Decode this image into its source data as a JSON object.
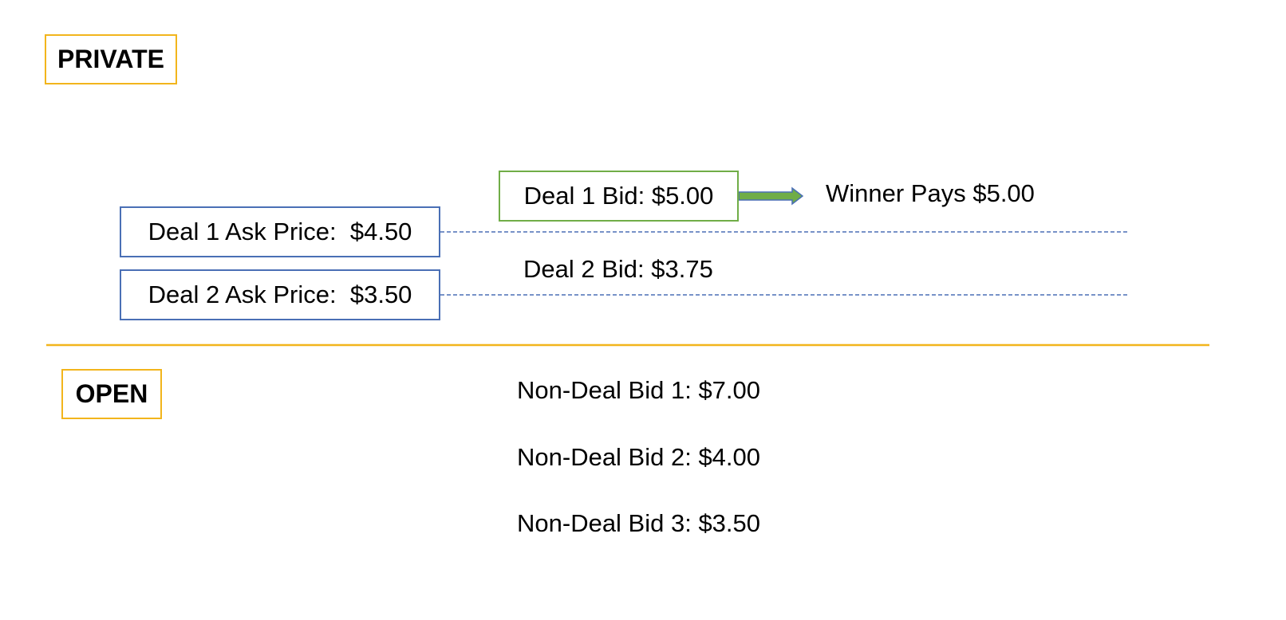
{
  "sections": {
    "private_label": "PRIVATE",
    "open_label": "OPEN"
  },
  "private": {
    "ask_prices": [
      {
        "label": "Deal 1 Ask Price:  $4.50"
      },
      {
        "label": "Deal 2 Ask Price:  $3.50"
      }
    ],
    "deal_bids": [
      {
        "label": "Deal 1 Bid: $5.00"
      },
      {
        "label": "Deal 2 Bid: $3.75"
      }
    ],
    "result": "Winner Pays $5.00"
  },
  "open": {
    "non_deal_bids": [
      {
        "label": "Non-Deal Bid 1: $7.00"
      },
      {
        "label": "Non-Deal Bid 2: $4.00"
      },
      {
        "label": "Non-Deal Bid 3: $3.50"
      }
    ]
  },
  "colors": {
    "section_border": "#F2B51C",
    "ask_border": "#4A6FB5",
    "winning_bid_border": "#70AD47",
    "divider": "#F2B51C",
    "dashed_line": "#4A6FB5",
    "arrow_fill": "#70AD47",
    "arrow_outline": "#4A6FB5"
  }
}
